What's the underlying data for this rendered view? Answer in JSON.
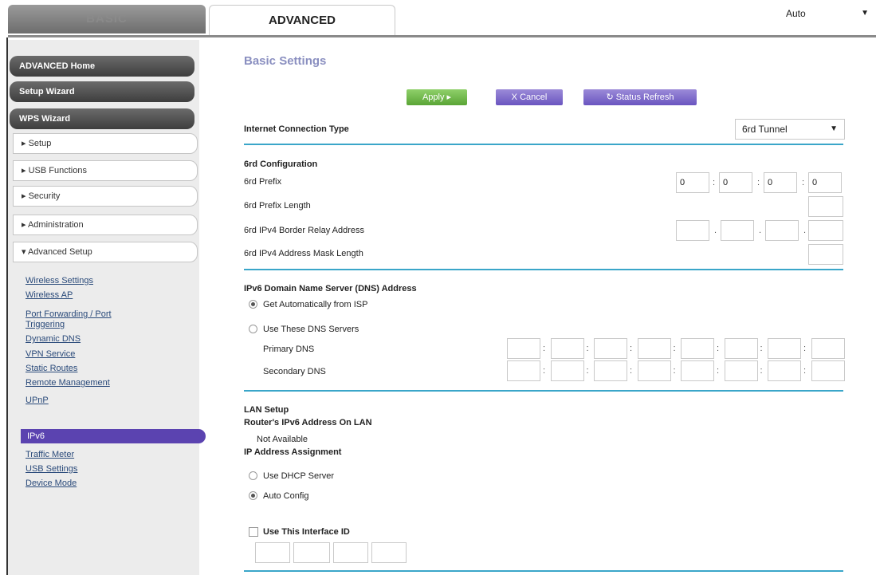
{
  "tabs": {
    "basic": "BASIC",
    "advanced": "ADVANCED"
  },
  "language": {
    "selected": "Auto"
  },
  "sidebar": {
    "top_buttons": [
      "ADVANCED Home",
      "Setup Wizard",
      "WPS Wizard"
    ],
    "menu": [
      "▸ Setup",
      "▸ USB Functions",
      "▸ Security",
      "▸ Administration",
      "▾ Advanced Setup"
    ],
    "submenu": [
      "Wireless Settings",
      "Wireless AP",
      "Port Forwarding / Port",
      "Triggering",
      "Dynamic DNS",
      "VPN Service",
      "Static Routes",
      "Remote Management",
      "UPnP",
      "IPv6",
      "Traffic Meter",
      "USB Settings",
      "Device Mode"
    ],
    "active": "IPv6"
  },
  "main": {
    "title": "Basic Settings",
    "buttons": {
      "apply": "Apply ▸",
      "cancel": "X Cancel",
      "refresh": "↻ Status Refresh"
    },
    "connection_type_label": "Internet Connection Type",
    "connection_type_value": "6rd Tunnel",
    "sixrd": {
      "heading": "6rd Configuration",
      "prefix_label": "6rd Prefix",
      "prefix_values": [
        "0",
        "0",
        "0",
        "0"
      ],
      "prefix_length_label": "6rd Prefix Length",
      "border_relay_label": "6rd IPv4 Border Relay Address",
      "mask_length_label": "6rd IPv4 Address Mask Length"
    },
    "dns": {
      "heading": "IPv6 Domain Name Server (DNS) Address",
      "option_auto": "Get Automatically from ISP",
      "option_manual": "Use These DNS Servers",
      "primary_label": "Primary DNS",
      "secondary_label": "Secondary DNS"
    },
    "lan": {
      "heading": "LAN Setup",
      "router_addr_label": "Router's IPv6 Address On LAN",
      "router_addr_value": "Not Available",
      "assign_label": "IP Address Assignment",
      "option_dhcp": "Use DHCP Server",
      "option_auto": "Auto Config",
      "interface_id_label": "Use This Interface ID"
    }
  }
}
